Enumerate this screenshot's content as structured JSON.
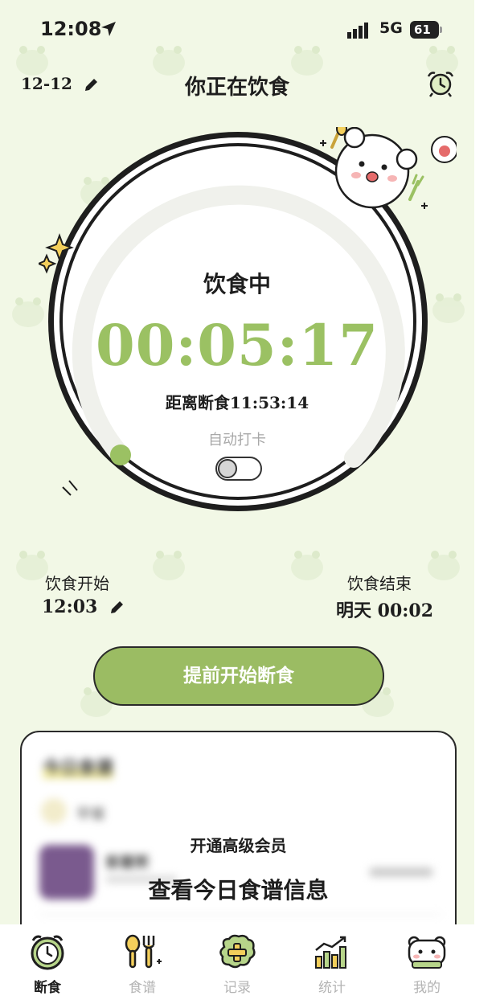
{
  "status_bar": {
    "time": "12:08",
    "network": "5G",
    "battery": "61"
  },
  "header": {
    "date": "12-12",
    "title": "你正在饮食"
  },
  "dial": {
    "state_label": "饮食中",
    "elapsed": "00:05:17",
    "countdown": "距离断食11:53:14",
    "auto_checkin_label": "自动打卡",
    "auto_checkin_on": false
  },
  "schedule": {
    "start_label": "饮食开始",
    "start_time": "12:03",
    "end_label": "饮食结束",
    "end_time": "明天 00:02"
  },
  "primary_button": {
    "label": "提前开始断食"
  },
  "recipe_card": {
    "blurred_title": "今日食谱",
    "blurred_meal": "早餐",
    "blurred_item": "紫薯粥",
    "member_line": "开通高级会员",
    "cta": "查看今日食谱信息"
  },
  "tabs": [
    {
      "label": "断食",
      "icon": "clock-icon",
      "active": true
    },
    {
      "label": "食谱",
      "icon": "fork-spoon-icon",
      "active": false
    },
    {
      "label": "记录",
      "icon": "add-record-icon",
      "active": false
    },
    {
      "label": "统计",
      "icon": "stats-chart-icon",
      "active": false
    },
    {
      "label": "我的",
      "icon": "bear-profile-icon",
      "active": false
    }
  ],
  "colors": {
    "background": "#f2f8e6",
    "accent_green": "#9bc163",
    "button_green": "#9bbc63",
    "text": "#1e1e1e"
  }
}
